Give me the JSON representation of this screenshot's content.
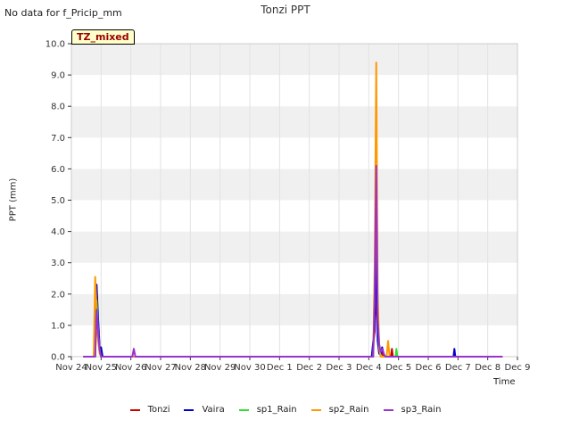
{
  "header": {
    "no_data": "No data for f_Pricip_mm",
    "title": "Tonzi PPT",
    "tag": "TZ_mixed"
  },
  "chart_data": {
    "type": "line",
    "title": "Tonzi PPT",
    "xlabel": "Time",
    "ylabel": "PPT (mm)",
    "ylim": [
      0,
      10
    ],
    "xlim": [
      0,
      15
    ],
    "x_unit_note_hidden": null,
    "y_ticks": [
      "0.0",
      "1.0",
      "2.0",
      "3.0",
      "4.0",
      "5.0",
      "6.0",
      "7.0",
      "8.0",
      "9.0",
      "10.0"
    ],
    "x_ticks": [
      "Nov 24",
      "Nov 25",
      "Nov 26",
      "Nov 27",
      "Nov 28",
      "Nov 29",
      "Nov 30",
      "Dec 1",
      "Dec 2",
      "Dec 3",
      "Dec 4",
      "Dec 5",
      "Dec 6",
      "Dec 7",
      "Dec 8",
      "Dec 9"
    ],
    "grid": true,
    "legend_position": "bottom",
    "series": [
      {
        "name": "Tonzi",
        "color": "#cc0000",
        "x": [
          0.4,
          0.75,
          0.8,
          0.85,
          0.9,
          0.95,
          1.0,
          10.1,
          10.2,
          10.25,
          10.3,
          10.35,
          10.4,
          10.45,
          10.5,
          10.55,
          10.75,
          10.78,
          10.81,
          14.5
        ],
        "y": [
          0,
          0,
          0.5,
          1.2,
          0.6,
          0.2,
          0,
          0,
          0.8,
          2.2,
          0.9,
          0.3,
          0.2,
          0.1,
          0,
          0,
          0,
          0.25,
          0,
          0
        ]
      },
      {
        "name": "Vaira",
        "color": "#0000cc",
        "x": [
          0.4,
          0.8,
          0.85,
          0.9,
          0.95,
          1.0,
          1.05,
          10.1,
          10.2,
          10.25,
          10.3,
          10.35,
          10.4,
          10.45,
          10.5,
          10.55,
          12.85,
          12.88,
          12.91,
          14.5
        ],
        "y": [
          0,
          0,
          2.3,
          1.2,
          0.3,
          0.3,
          0,
          0,
          1.0,
          3.5,
          0.5,
          0.1,
          0.05,
          0.3,
          0.1,
          0,
          0,
          0.25,
          0,
          0
        ]
      },
      {
        "name": "sp1_Rain",
        "color": "#33dd33",
        "x": [
          0.4,
          0.8,
          0.85,
          0.9,
          0.95,
          1.0,
          10.15,
          10.2,
          10.25,
          10.3,
          10.35,
          10.4,
          10.5,
          10.9,
          10.93,
          10.96,
          14.5
        ],
        "y": [
          0,
          0,
          1.8,
          0.8,
          0.2,
          0,
          0,
          2.0,
          6.6,
          1.5,
          0.3,
          0,
          0,
          0,
          0.25,
          0,
          0
        ]
      },
      {
        "name": "sp2_Rain",
        "color": "#ff9900",
        "x": [
          0.4,
          0.75,
          0.8,
          0.85,
          0.9,
          0.95,
          1.0,
          10.15,
          10.2,
          10.25,
          10.3,
          10.35,
          10.4,
          10.5,
          10.6,
          10.65,
          10.7,
          14.5
        ],
        "y": [
          0,
          0,
          2.55,
          1.5,
          0.5,
          0.1,
          0,
          0,
          3.0,
          9.4,
          2.0,
          0.3,
          0,
          0,
          0,
          0.5,
          0,
          0
        ]
      },
      {
        "name": "sp3_Rain",
        "color": "#9933cc",
        "x": [
          0.4,
          0.8,
          0.85,
          0.9,
          0.95,
          1.0,
          2.05,
          2.1,
          2.15,
          10.15,
          10.2,
          10.25,
          10.3,
          10.35,
          10.4,
          10.45,
          10.5,
          10.55,
          14.5
        ],
        "y": [
          0,
          0,
          1.5,
          0.8,
          0.2,
          0,
          0,
          0.25,
          0,
          0,
          2.0,
          6.1,
          1.2,
          0.4,
          0.15,
          0.25,
          0.1,
          0,
          0
        ]
      }
    ]
  }
}
